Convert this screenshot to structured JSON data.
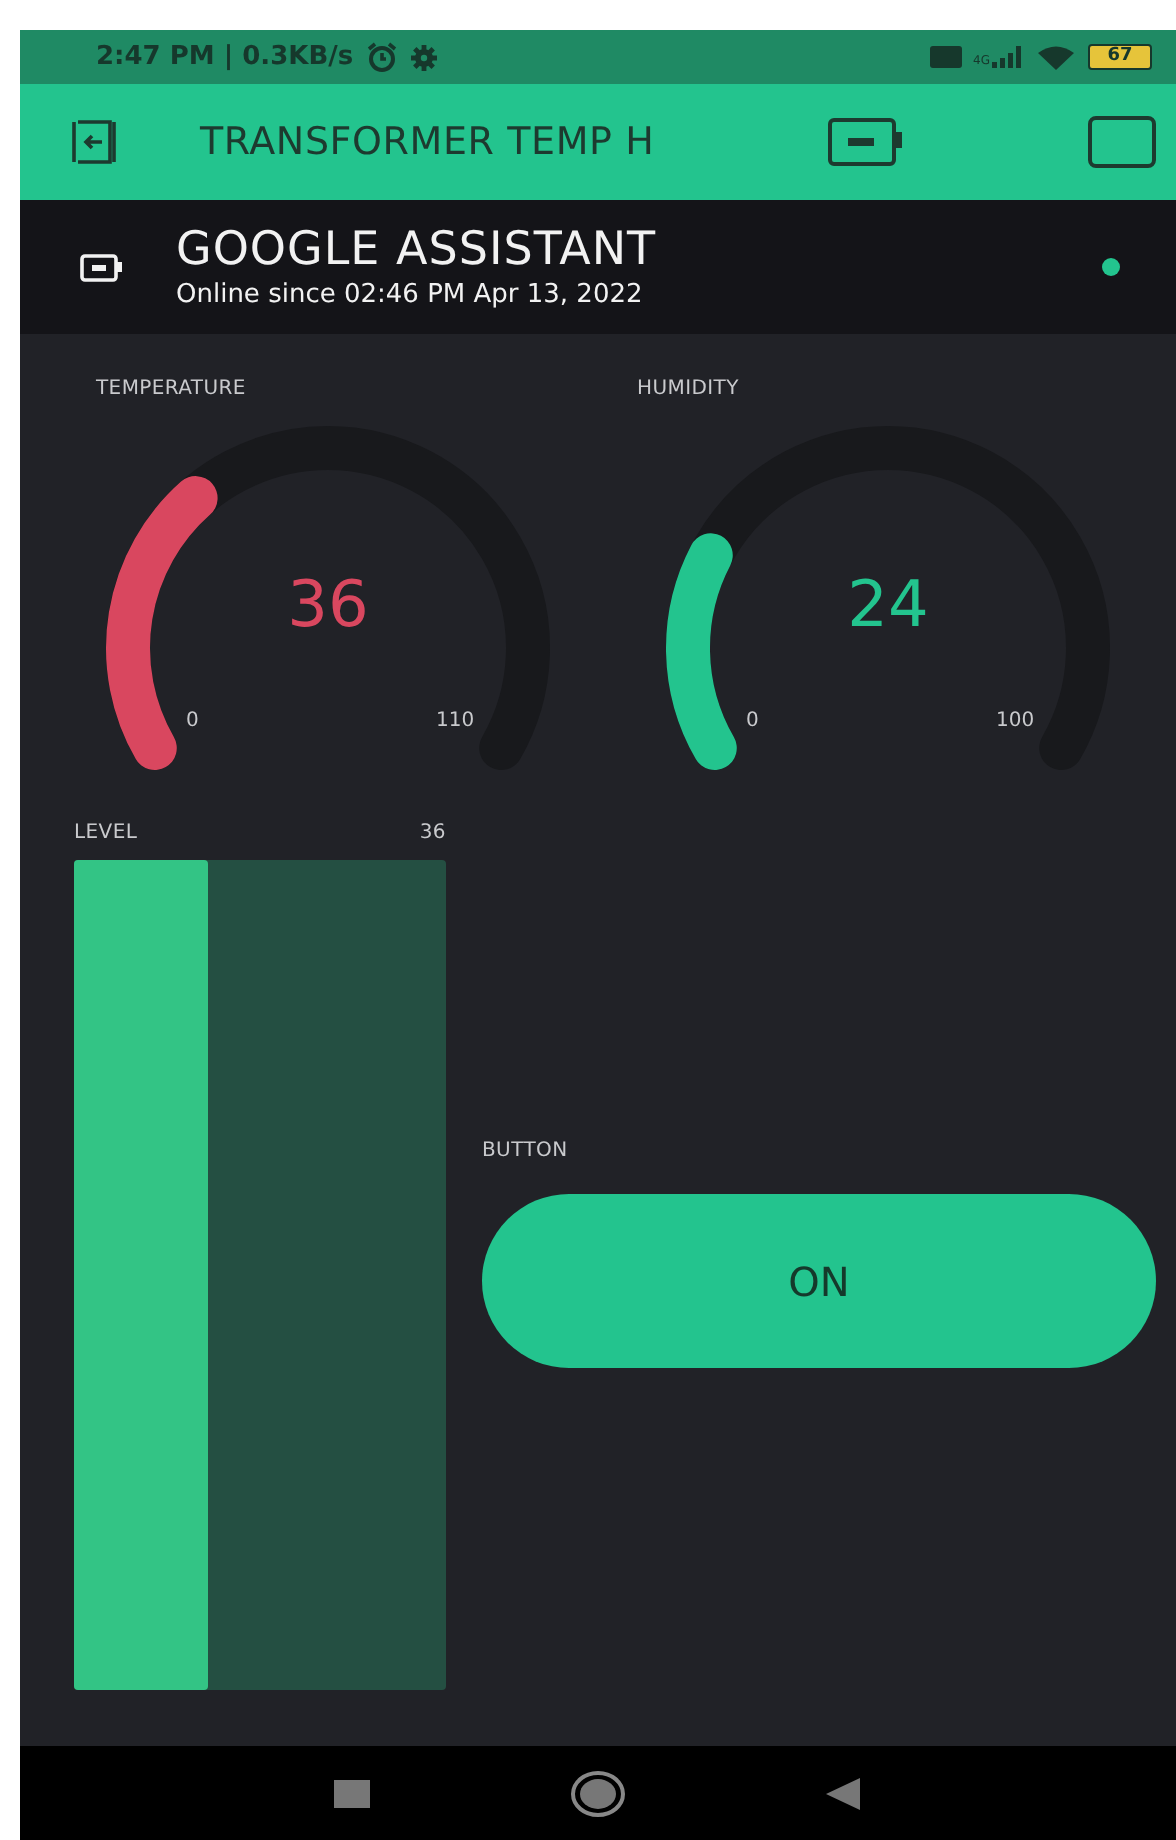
{
  "status_bar": {
    "time_speed": "2:47 PM | 0.3KB/s",
    "network": "4G",
    "battery": "67"
  },
  "header": {
    "title": "TRANSFORMER TEMP H"
  },
  "device": {
    "name": "GOOGLE ASSISTANT",
    "status": "Online since 02:46 PM Apr 13, 2022",
    "online": true
  },
  "gauges": [
    {
      "label": "TEMPERATURE",
      "value": "36",
      "min": "0",
      "max": "110",
      "color": "#d9475f"
    },
    {
      "label": "HUMIDITY",
      "value": "24",
      "min": "0",
      "max": "100",
      "color": "#23c48e"
    }
  ],
  "level_widget": {
    "label": "LEVEL",
    "value": "36"
  },
  "button_widget": {
    "label": "BUTTON",
    "text": "ON",
    "on": true
  }
}
